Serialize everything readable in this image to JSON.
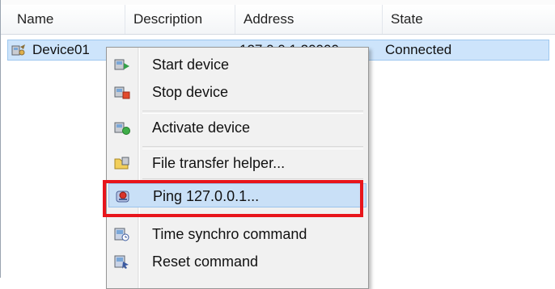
{
  "table": {
    "columns": [
      "Name",
      "Description",
      "Address",
      "State"
    ],
    "row": {
      "name": "Device01",
      "address": "127.0.0.1:20000",
      "state": "Connected"
    }
  },
  "menu": {
    "items": [
      {
        "label": "Start device",
        "icon": "start-device-icon"
      },
      {
        "label": "Stop device",
        "icon": "stop-device-icon"
      },
      {
        "label": "Activate device",
        "icon": "activate-device-icon"
      },
      {
        "label": "File transfer helper...",
        "icon": "file-transfer-icon"
      },
      {
        "label": "Ping 127.0.0.1...",
        "icon": "ping-icon"
      },
      {
        "label": "Time synchro command",
        "icon": "time-synchro-icon"
      },
      {
        "label": "Reset command",
        "icon": "reset-icon"
      }
    ]
  },
  "colors": {
    "selection": "#cde4fb",
    "highlight_outline": "#e8151b"
  }
}
